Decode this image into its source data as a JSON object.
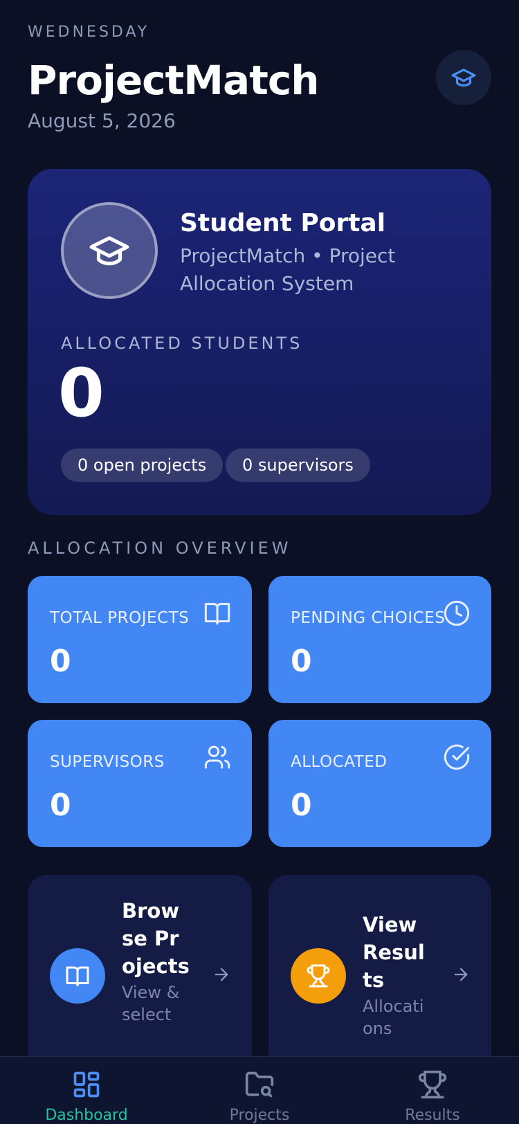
{
  "header": {
    "weekday": "WEDNESDAY",
    "title": "ProjectMatch",
    "date": "August 5, 2026",
    "profile_icon": "graduation-cap-icon"
  },
  "portal": {
    "title": "Student Portal",
    "subtitle": "ProjectMatch • Project Allocation System",
    "allocated_label": "ALLOCATED STUDENTS",
    "allocated_value": "0",
    "pill_projects": "0 open projects",
    "pill_supervisors": "0 supervisors"
  },
  "overview": {
    "section_label": "ALLOCATION OVERVIEW",
    "stats": [
      {
        "label": "TOTAL PROJECTS",
        "value": "0",
        "icon": "book-open-icon"
      },
      {
        "label": "PENDING CHOICES",
        "value": "0",
        "icon": "clock-icon"
      },
      {
        "label": "SUPERVISORS",
        "value": "0",
        "icon": "users-icon"
      },
      {
        "label": "ALLOCATED",
        "value": "0",
        "icon": "check-circle-icon"
      }
    ]
  },
  "actions": [
    {
      "title": "Browse Projects",
      "subtitle": "View & select",
      "icon": "book-open-icon",
      "color": "#4387f5"
    },
    {
      "title": "View Results",
      "subtitle": "Allocations",
      "icon": "trophy-icon",
      "color": "#f59e0b"
    }
  ],
  "tabbar": {
    "items": [
      {
        "label": "Dashboard",
        "icon": "grid-icon",
        "active": true
      },
      {
        "label": "Projects",
        "icon": "folder-search-icon",
        "active": false
      },
      {
        "label": "Results",
        "icon": "trophy-icon",
        "active": false
      }
    ]
  },
  "colors": {
    "background": "#0b1024",
    "accent_blue": "#4387f5",
    "accent_orange": "#f59e0b",
    "active_tab": "#22c3a0"
  }
}
